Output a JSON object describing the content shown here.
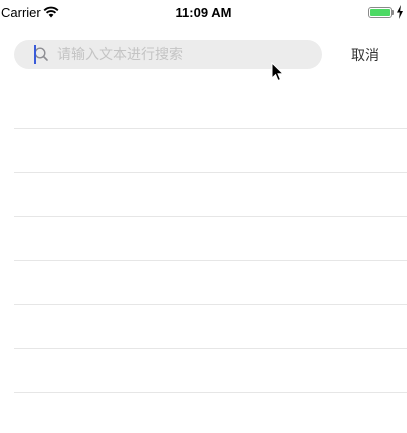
{
  "status_bar": {
    "carrier": "Carrier",
    "time": "11:09 AM",
    "battery_level": 1.0
  },
  "search": {
    "placeholder": "请输入文本进行搜索",
    "value": "",
    "cancel_label": "取消"
  },
  "results": [
    "",
    "",
    "",
    "",
    "",
    "",
    ""
  ],
  "colors": {
    "search_background": "#ececec",
    "caret": "#3a5bd9",
    "battery": "#4cd964",
    "separator": "#e6e6e6"
  }
}
